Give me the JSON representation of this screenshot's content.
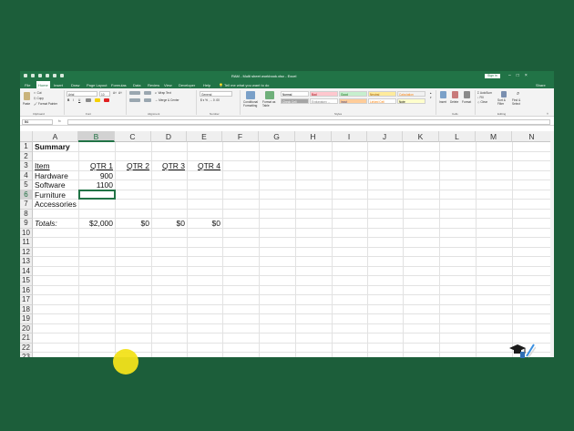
{
  "window": {
    "title": "RAM - Multi sheet workbook.xlsx - Excel",
    "sign_in": "Sign in"
  },
  "tabs": [
    "File",
    "Home",
    "Insert",
    "Draw",
    "Page Layout",
    "Formulas",
    "Data",
    "Review",
    "View",
    "Developer",
    "Help"
  ],
  "active_tab": "Home",
  "tell_me": "Tell me what you want to do",
  "share": "Share",
  "ribbon": {
    "clipboard": {
      "paste": "Paste",
      "cut": "Cut",
      "copy": "Copy",
      "format_painter": "Format Painter",
      "group": "Clipboard"
    },
    "font": {
      "font_name": "Arial",
      "font_size": "10",
      "group": "Font"
    },
    "alignment": {
      "wrap_text": "Wrap Text",
      "merge_center": "Merge & Center",
      "group": "Alignment"
    },
    "number": {
      "format": "General",
      "group": "Number"
    },
    "styles": {
      "conditional_formatting": "Conditional Formatting",
      "format_as_table": "Format as Table",
      "cells": [
        {
          "label": "Normal",
          "bg": "#ffffff",
          "fg": "#000000"
        },
        {
          "label": "Bad",
          "bg": "#ffc7ce",
          "fg": "#9c0006"
        },
        {
          "label": "Good",
          "bg": "#c6efce",
          "fg": "#006100"
        },
        {
          "label": "Neutral",
          "bg": "#ffeb9c",
          "fg": "#9c5700"
        },
        {
          "label": "Calculation",
          "bg": "#f2f2f2",
          "fg": "#fa7d00"
        },
        {
          "label": "Check Cell",
          "bg": "#a5a5a5",
          "fg": "#ffffff"
        },
        {
          "label": "Explanatory ...",
          "bg": "#ffffff",
          "fg": "#7f7f7f"
        },
        {
          "label": "Input",
          "bg": "#ffcc99",
          "fg": "#3f3f76"
        },
        {
          "label": "Linked Cell",
          "bg": "#ffffff",
          "fg": "#fa7d00"
        },
        {
          "label": "Note",
          "bg": "#ffffcc",
          "fg": "#000000"
        }
      ],
      "group": "Styles"
    },
    "cells_group": {
      "insert": "Insert",
      "delete": "Delete",
      "format": "Format",
      "group": "Cells"
    },
    "editing": {
      "autosum": "AutoSum",
      "fill": "Fill",
      "clear": "Clear",
      "sort_filter": "Sort & Filter",
      "find_select": "Find & Select",
      "group": "Editing"
    }
  },
  "formula_bar": {
    "name_box": "B6",
    "fx": "fx",
    "value": ""
  },
  "columns": [
    "A",
    "B",
    "C",
    "D",
    "E",
    "F",
    "G",
    "H",
    "I",
    "J",
    "K",
    "L",
    "M",
    "N"
  ],
  "rows": [
    "1",
    "2",
    "3",
    "4",
    "5",
    "6",
    "7",
    "8",
    "9",
    "10",
    "11",
    "12",
    "13",
    "14",
    "15",
    "16",
    "17",
    "18",
    "19",
    "20",
    "21",
    "22",
    "23"
  ],
  "cells": {
    "A1": "Summary",
    "A3": "Item",
    "B3": "QTR 1",
    "C3": "QTR 2",
    "D3": "QTR 3",
    "E3": "QTR 4",
    "A4": "Hardware",
    "B4": "900",
    "A5": "Software",
    "B5": "1100",
    "A6": "Furniture",
    "A7": "Accessories",
    "A9": "Totals:",
    "B9": "$2,000",
    "C9": "$0",
    "D9": "$0",
    "E9": "$0"
  },
  "active_cell": "B6",
  "colors": {
    "excel_green": "#217346",
    "background": "#1c5e3a",
    "cursor_highlight": "#f2e21a"
  }
}
